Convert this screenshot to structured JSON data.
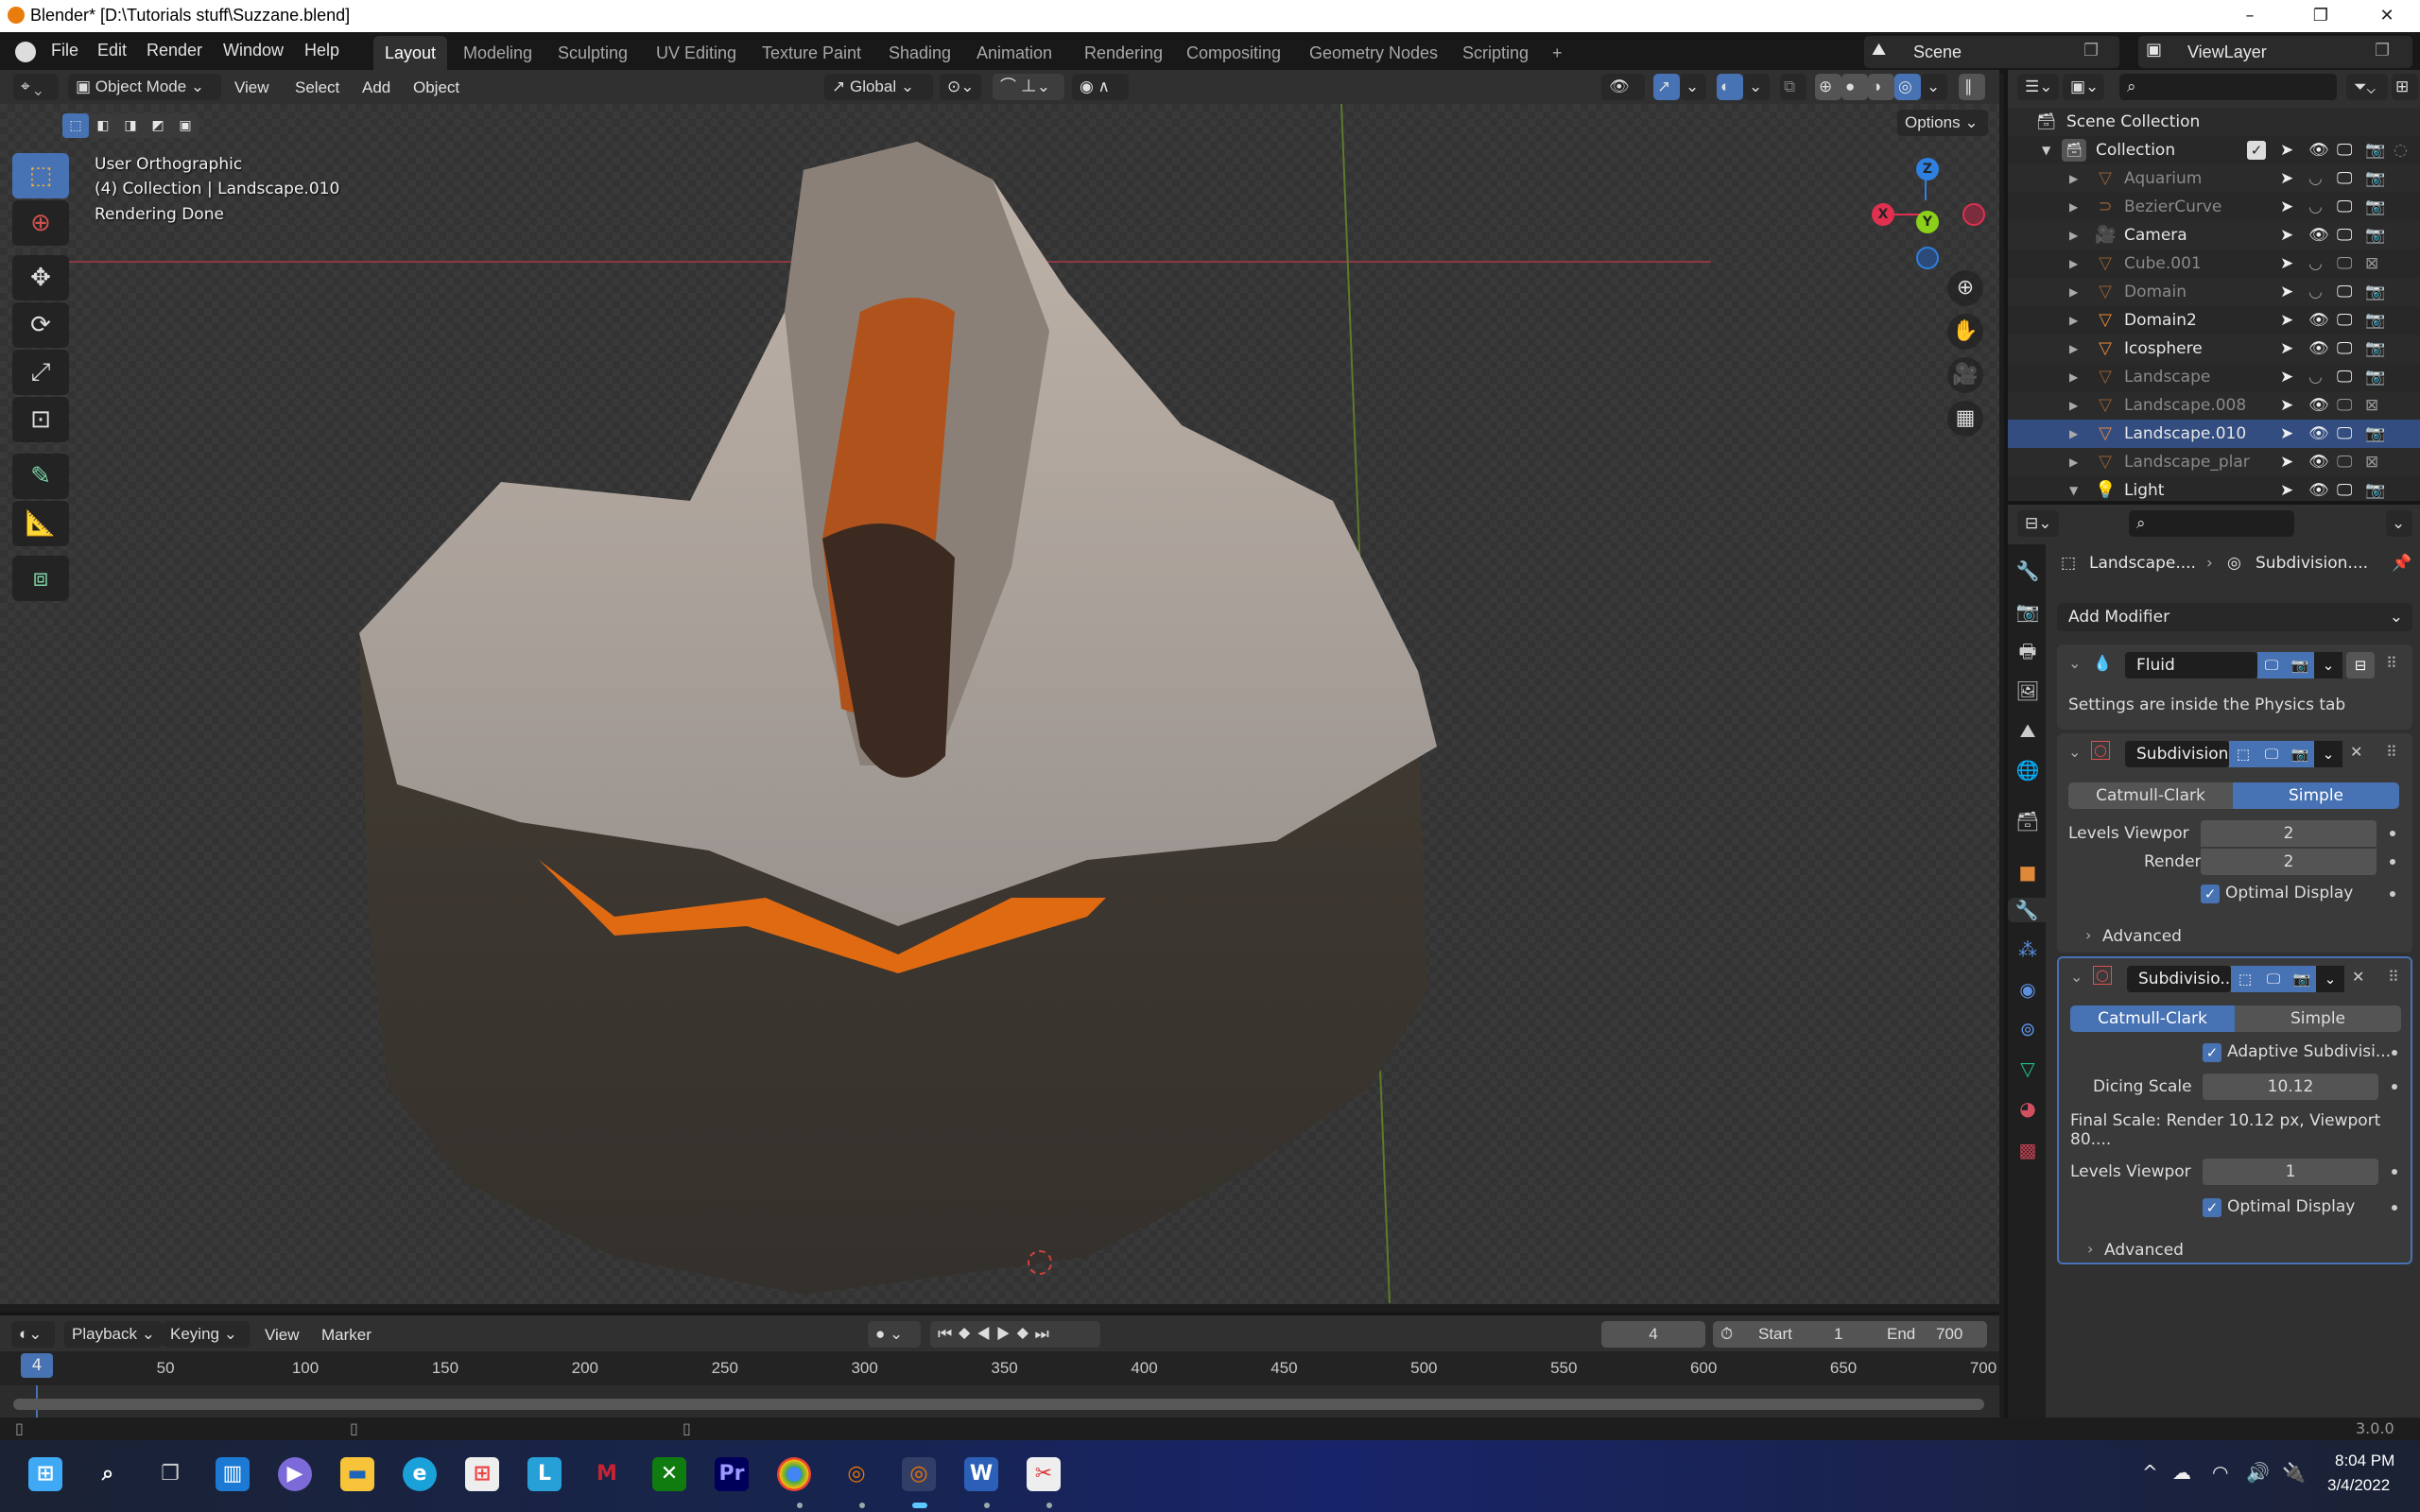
{
  "window": {
    "title": "Blender* [D:\\Tutorials stuff\\Suzzane.blend]",
    "minimize": "–",
    "maximize": "❐",
    "close": "✕"
  },
  "menu": [
    "File",
    "Edit",
    "Render",
    "Window",
    "Help"
  ],
  "workspaces": [
    "Layout",
    "Modeling",
    "Sculpting",
    "UV Editing",
    "Texture Paint",
    "Shading",
    "Animation",
    "Rendering",
    "Compositing",
    "Geometry Nodes",
    "Scripting"
  ],
  "active_workspace": "Layout",
  "add_workspace": "+",
  "scene": {
    "label": "Scene"
  },
  "view_layer": {
    "label": "ViewLayer"
  },
  "viewport_header": {
    "mode": "Object Mode",
    "menus": [
      "View",
      "Select",
      "Add",
      "Object"
    ],
    "transform_orientation": "Global",
    "options": "Options"
  },
  "viewport_overlay": {
    "view_name": "User Orthographic",
    "collection_info": "(4) Collection | Landscape.010",
    "status": "Rendering Done"
  },
  "gizmo": {
    "x": "X",
    "y": "Y",
    "z": "Z"
  },
  "outliner": {
    "scene_collection": "Scene Collection",
    "collection": "Collection",
    "items": [
      {
        "name": "Aquarium",
        "type": "mesh",
        "dim": true,
        "visible": false,
        "render": true
      },
      {
        "name": "BezierCurve",
        "type": "curve",
        "dim": true,
        "visible": false,
        "render": true
      },
      {
        "name": "Camera",
        "type": "camera",
        "dim": false,
        "visible": true,
        "render": true
      },
      {
        "name": "Cube.001",
        "type": "mesh",
        "dim": true,
        "visible": false,
        "render": false
      },
      {
        "name": "Domain",
        "type": "mesh",
        "dim": true,
        "visible": false,
        "render": true
      },
      {
        "name": "Domain2",
        "type": "mesh",
        "dim": false,
        "visible": true,
        "render": true
      },
      {
        "name": "Icosphere",
        "type": "mesh",
        "dim": false,
        "visible": true,
        "render": true
      },
      {
        "name": "Landscape",
        "type": "mesh",
        "dim": true,
        "visible": false,
        "render": true
      },
      {
        "name": "Landscape.008",
        "type": "mesh",
        "dim": true,
        "visible": true,
        "render": false
      },
      {
        "name": "Landscape.010",
        "type": "mesh",
        "dim": false,
        "visible": true,
        "render": true,
        "active": true
      },
      {
        "name": "Landscape_plar",
        "type": "mesh",
        "dim": true,
        "visible": true,
        "render": false
      },
      {
        "name": "Light",
        "type": "light",
        "dim": false,
        "visible": true,
        "render": true
      }
    ]
  },
  "properties": {
    "breadcrumb_object": "Landscape....",
    "breadcrumb_modifier": "Subdivision....",
    "add_modifier": "Add Modifier",
    "fluid": {
      "name": "Fluid",
      "note": "Settings are inside the Physics tab"
    },
    "subdiv1": {
      "name": "Subdivision",
      "type_options": [
        "Catmull-Clark",
        "Simple"
      ],
      "selected_type": "Simple",
      "levels_viewport_label": "Levels Viewpor",
      "levels_viewport": "2",
      "render_label": "Render",
      "render": "2",
      "optimal_display": "Optimal Display",
      "advanced": "Advanced"
    },
    "subdiv2": {
      "name": "Subdivisio...",
      "type_options": [
        "Catmull-Clark",
        "Simple"
      ],
      "selected_type": "Catmull-Clark",
      "adaptive": "Adaptive Subdivisi...",
      "dicing_scale_label": "Dicing Scale",
      "dicing_scale": "10.12",
      "final_scale": "Final Scale: Render 10.12 px, Viewport 80....",
      "levels_viewport_label": "Levels Viewpor",
      "levels_viewport": "1",
      "optimal_display": "Optimal Display",
      "advanced": "Advanced"
    }
  },
  "timeline": {
    "menus": [
      "Playback",
      "Keying",
      "View",
      "Marker"
    ],
    "current_frame": "4",
    "start_label": "Start",
    "start": "1",
    "end_label": "End",
    "end": "700",
    "ticks": [
      "50",
      "100",
      "150",
      "200",
      "250",
      "300",
      "350",
      "400",
      "450",
      "500",
      "550",
      "600",
      "650",
      "700"
    ]
  },
  "status_version": "3.0.0",
  "taskbar": {
    "apps": [
      "start",
      "search",
      "task-view",
      "widgets",
      "teams-chat",
      "file-explorer",
      "edge",
      "store",
      "l-app",
      "mcafee",
      "xbox",
      "premiere-pro",
      "chrome",
      "blender",
      "blender-active",
      "word",
      "snipping-tool"
    ],
    "time": "8:04 PM",
    "date": "3/4/2022"
  }
}
